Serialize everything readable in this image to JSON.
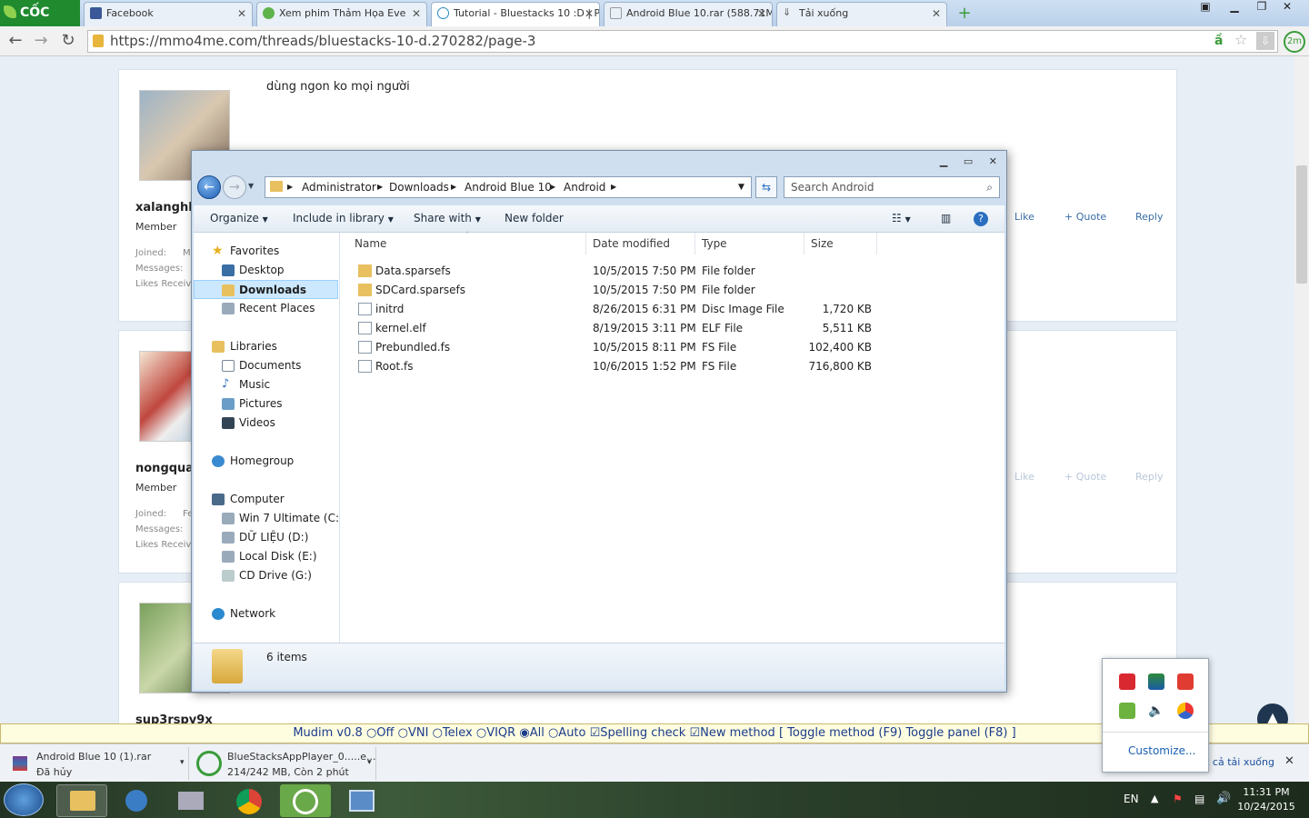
{
  "browser": {
    "logo": "CỐC CỐC",
    "tabs": [
      {
        "title": "Facebook"
      },
      {
        "title": "Xem phim Thảm Họa Eve"
      },
      {
        "title": "Tutorial - Bluestacks 10 :D | P"
      },
      {
        "title": "Android Blue 10.rar (588.71M"
      },
      {
        "title": "Tải xuống"
      }
    ],
    "url": "https://mmo4me.com/threads/bluestacks-10-d.270282/page-3",
    "timer_badge": "2m"
  },
  "page": {
    "posts": [
      {
        "username": "xalanghk",
        "role": "Member",
        "meta": [
          "Joined:",
          "Messages:",
          "Likes Received:"
        ],
        "joined_value": "M",
        "message": "dùng ngon ko mọi người",
        "actions": [
          "Like",
          "+ Quote",
          "Reply"
        ]
      },
      {
        "username": "nongqua2",
        "role": "Member",
        "meta": [
          "Joined:",
          "Messages:",
          "Likes Received:"
        ],
        "joined_value": "Fe",
        "actions": [
          "Like",
          "+ Quote",
          "Reply"
        ]
      },
      {
        "username": "sup3rspy9x"
      }
    ]
  },
  "explorer": {
    "breadcrumb": [
      "Administrator",
      "Downloads",
      "Android Blue 10",
      "Android"
    ],
    "search_placeholder": "Search Android",
    "toolbar": [
      "Organize",
      "Include in library",
      "Share with",
      "New folder"
    ],
    "nav": {
      "favorites": {
        "label": "Favorites",
        "items": [
          "Desktop",
          "Downloads",
          "Recent Places"
        ]
      },
      "libraries": {
        "label": "Libraries",
        "items": [
          "Documents",
          "Music",
          "Pictures",
          "Videos"
        ]
      },
      "homegroup": "Homegroup",
      "computer": {
        "label": "Computer",
        "items": [
          "Win 7 Ultimate (C:)",
          "DỮ LIỆU (D:)",
          "Local Disk (E:)",
          "CD Drive (G:)"
        ]
      },
      "network": "Network"
    },
    "columns": [
      "Name",
      "Date modified",
      "Type",
      "Size"
    ],
    "files": [
      {
        "name": "Data.sparsefs",
        "date": "10/5/2015 7:50 PM",
        "type": "File folder",
        "size": ""
      },
      {
        "name": "SDCard.sparsefs",
        "date": "10/5/2015 7:50 PM",
        "type": "File folder",
        "size": ""
      },
      {
        "name": "initrd",
        "date": "8/26/2015 6:31 PM",
        "type": "Disc Image File",
        "size": "1,720 KB"
      },
      {
        "name": "kernel.elf",
        "date": "8/19/2015 3:11 PM",
        "type": "ELF File",
        "size": "5,511 KB"
      },
      {
        "name": "Prebundled.fs",
        "date": "10/5/2015 8:11 PM",
        "type": "FS File",
        "size": "102,400 KB"
      },
      {
        "name": "Root.fs",
        "date": "10/6/2015 1:52 PM",
        "type": "FS File",
        "size": "716,800 KB"
      }
    ],
    "status": "6 items"
  },
  "mudim": {
    "title": "Mudim v0.8",
    "options": [
      "Off",
      "VNI",
      "Telex",
      "VIQR",
      "All",
      "Auto"
    ],
    "checks": [
      "Spelling check",
      "New method"
    ],
    "toggles": "[ Toggle method (F9) Toggle panel (F8) ]"
  },
  "downloads": [
    {
      "name": "Android Blue 10 (1).rar",
      "status": "Đã hủy"
    },
    {
      "name": "BlueStacksAppPlayer_0.....e...",
      "status": "214/242 MB, Còn 2 phút"
    }
  ],
  "shelf_link": "Hiển thị tất cả tải xuống...",
  "tray": {
    "customize": "Customize...",
    "lang": "EN",
    "time": "11:31 PM",
    "date": "10/24/2015"
  }
}
